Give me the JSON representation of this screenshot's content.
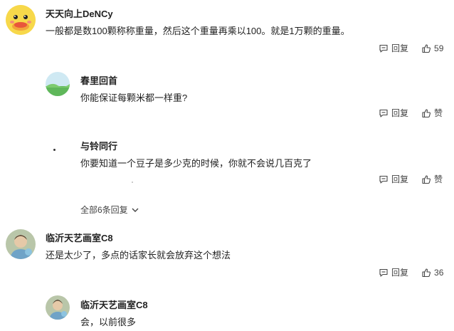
{
  "comments": [
    {
      "author": "天天向上DeNCy",
      "text": "一般都是数100颗称称重量，然后这个重量再乘以100。就是1万颗的重量。",
      "reply_label": "回复",
      "like_label": "59"
    },
    {
      "author": "春里回首",
      "text": "你能保证每颗米都一样重?",
      "reply_label": "回复",
      "like_label": "赞"
    },
    {
      "author": "与铃同行",
      "text": "你要知道一个豆子是多少克的时候，你就不会说几百克了",
      "reply_label": "回复",
      "like_label": "赞"
    },
    {
      "author": "临沂天艺画室C8",
      "text": "还是太少了，多点的话家长就会放弃这个想法",
      "reply_label": "回复",
      "like_label": "36"
    },
    {
      "author": "临沂天艺画室C8",
      "text": "会，以前很多"
    }
  ],
  "expand_replies_label": "全部6条回复"
}
